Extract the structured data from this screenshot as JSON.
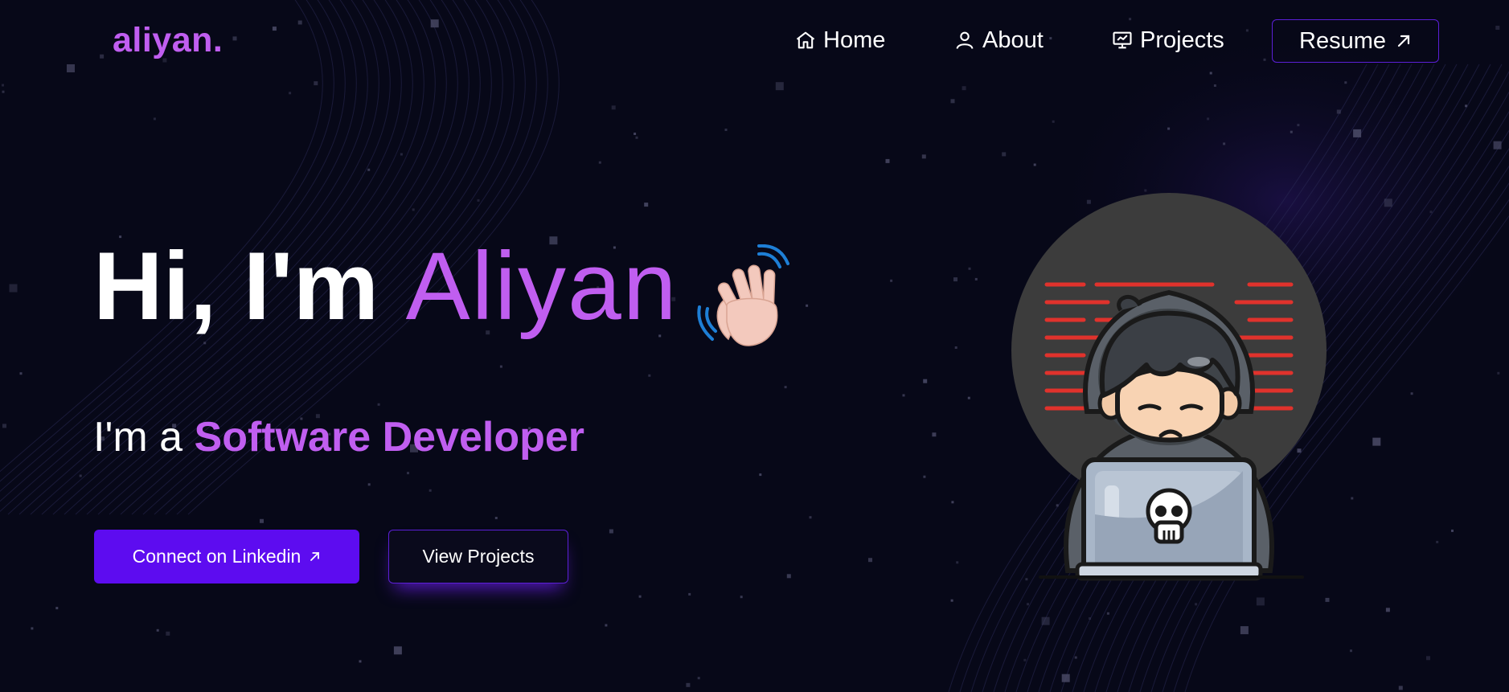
{
  "brand": {
    "logo": "aliyan."
  },
  "nav": {
    "items": [
      {
        "label": "Home",
        "icon": "home-icon"
      },
      {
        "label": "About",
        "icon": "user-icon"
      },
      {
        "label": "Projects",
        "icon": "presentation-chart-icon"
      }
    ],
    "resume": {
      "label": "Resume",
      "icon": "arrow-up-right-icon"
    }
  },
  "hero": {
    "greeting": "Hi, I'm",
    "name": "Aliyan",
    "wave_icon": "waving-hand-icon",
    "intro": "I'm a",
    "role": "Software Developer",
    "primary_button": {
      "label": "Connect on Linkedin",
      "icon": "arrow-up-right-icon"
    },
    "secondary_button": {
      "label": "View Projects"
    },
    "illustration": "hacker-with-laptop-illustration"
  },
  "colors": {
    "background": "#070818",
    "accent": "#c05ef0",
    "button_primary": "#5d0cf0",
    "button_border": "#5b1fd6",
    "text": "#ffffff"
  }
}
